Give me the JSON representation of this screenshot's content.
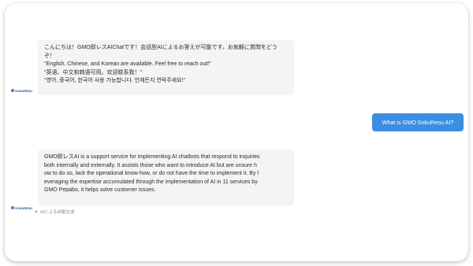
{
  "chat": {
    "bot_avatar_label": "SOKURESU",
    "message_1_lines": [
      "こんにちは！GMO即レスAIChatです！会話型AIによるお答えが可能です。お気軽に質問をどう",
      "ぞ！",
      "\"English, Chinese, and Korean are available. Feel free to reach out!\"",
      "\"英语、中文和韩语可用。欢迎联系我！\"",
      "\"영어, 중국어, 한국어 사용 가능합니다. 언제든지 연락주세요!\""
    ],
    "user_message": "What is GMO SokuResu AI?",
    "message_2_lines": [
      "GMO即レスAI is a support service for implementing AI chatbots that respond to inquiries",
      "both internally and externally. It assists those who want to introduce AI but are unsure h",
      "ow to do so, lack the operational know-how, or do not have the time to implement it. By l",
      "everaging the expertise accumulated through the implementation of AI in 11 services by",
      "GMO Pepabo, it helps solve customer issues."
    ],
    "ai_generated_note": "AIによる自動生成"
  },
  "colors": {
    "user_bubble": "#3b8ee0",
    "bot_bubble": "#f3f4f6",
    "warning": "#e0a020"
  }
}
